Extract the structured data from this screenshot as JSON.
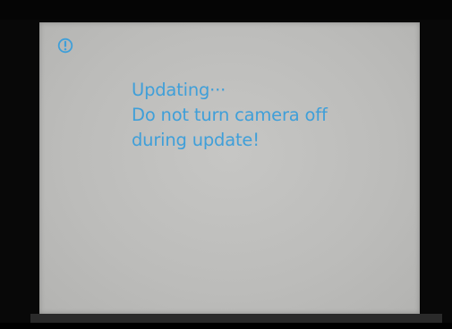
{
  "screen": {
    "icon": "warning-exclamation-icon",
    "accent_color": "#3f9fd9",
    "message_lines": [
      "Updating···",
      "Do not turn camera off",
      "during update!"
    ]
  }
}
